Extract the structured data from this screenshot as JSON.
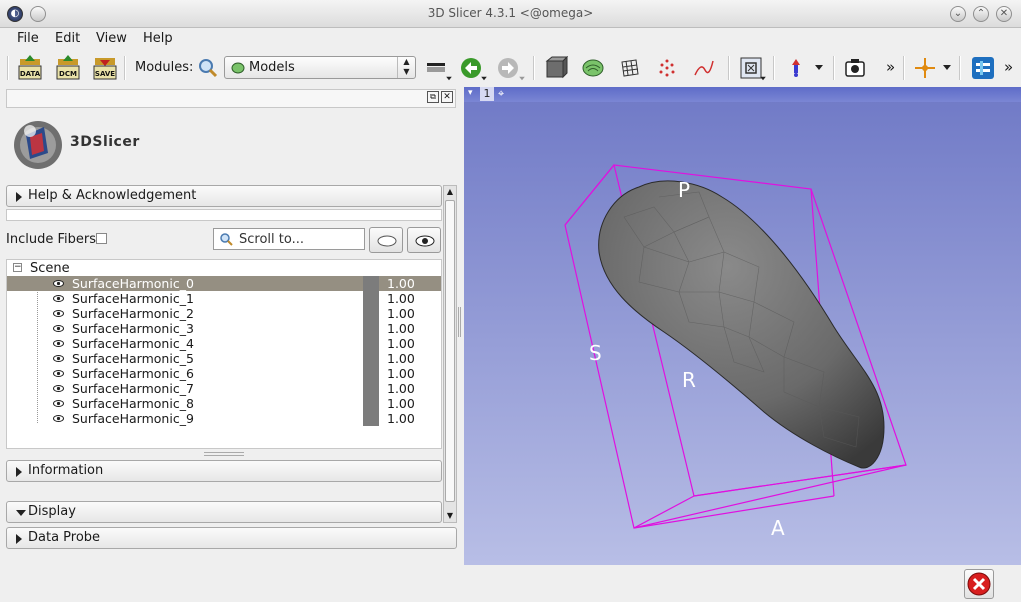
{
  "window": {
    "title": "3D Slicer 4.3.1 <@omega>"
  },
  "menu": {
    "file": "File",
    "edit": "Edit",
    "view": "View",
    "help": "Help"
  },
  "toolbar": {
    "data_label": "DATA",
    "dcm_label": "DCM",
    "save_label": "SAVE",
    "modules_label": "Modules:",
    "module_selected": "Models",
    "overflow1": "»",
    "overflow2": "»"
  },
  "left_panel": {
    "logo_text": "3DSlicer",
    "help_section": "Help & Acknowledgement",
    "include_fibers_label": "Include Fibers",
    "scroll_to_placeholder": "Scroll to...",
    "scene_label": "Scene",
    "models": [
      {
        "name": "SurfaceHarmonic_0",
        "opacity": "1.00"
      },
      {
        "name": "SurfaceHarmonic_1",
        "opacity": "1.00"
      },
      {
        "name": "SurfaceHarmonic_2",
        "opacity": "1.00"
      },
      {
        "name": "SurfaceHarmonic_3",
        "opacity": "1.00"
      },
      {
        "name": "SurfaceHarmonic_4",
        "opacity": "1.00"
      },
      {
        "name": "SurfaceHarmonic_5",
        "opacity": "1.00"
      },
      {
        "name": "SurfaceHarmonic_6",
        "opacity": "1.00"
      },
      {
        "name": "SurfaceHarmonic_7",
        "opacity": "1.00"
      },
      {
        "name": "SurfaceHarmonic_8",
        "opacity": "1.00"
      },
      {
        "name": "SurfaceHarmonic_9",
        "opacity": "1.00"
      }
    ],
    "information_section": "Information",
    "display_section": "Display",
    "data_probe_section": "Data Probe"
  },
  "viewer": {
    "view_number": "1",
    "labels": {
      "p": "P",
      "s": "S",
      "r": "R",
      "a": "A"
    },
    "colors": {
      "bbox": "#e010e0",
      "model": "#6a6a6a"
    }
  }
}
